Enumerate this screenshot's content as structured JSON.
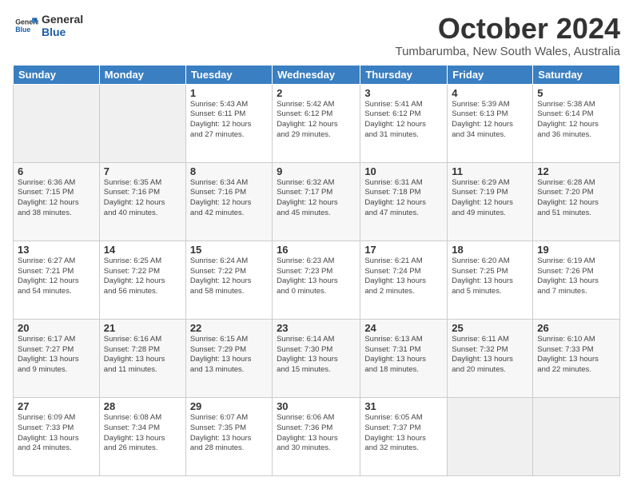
{
  "logo": {
    "line1": "General",
    "line2": "Blue"
  },
  "title": "October 2024",
  "subtitle": "Tumbarumba, New South Wales, Australia",
  "weekdays": [
    "Sunday",
    "Monday",
    "Tuesday",
    "Wednesday",
    "Thursday",
    "Friday",
    "Saturday"
  ],
  "weeks": [
    [
      {
        "day": "",
        "info": ""
      },
      {
        "day": "",
        "info": ""
      },
      {
        "day": "1",
        "info": "Sunrise: 5:43 AM\nSunset: 6:11 PM\nDaylight: 12 hours\nand 27 minutes."
      },
      {
        "day": "2",
        "info": "Sunrise: 5:42 AM\nSunset: 6:12 PM\nDaylight: 12 hours\nand 29 minutes."
      },
      {
        "day": "3",
        "info": "Sunrise: 5:41 AM\nSunset: 6:12 PM\nDaylight: 12 hours\nand 31 minutes."
      },
      {
        "day": "4",
        "info": "Sunrise: 5:39 AM\nSunset: 6:13 PM\nDaylight: 12 hours\nand 34 minutes."
      },
      {
        "day": "5",
        "info": "Sunrise: 5:38 AM\nSunset: 6:14 PM\nDaylight: 12 hours\nand 36 minutes."
      }
    ],
    [
      {
        "day": "6",
        "info": "Sunrise: 6:36 AM\nSunset: 7:15 PM\nDaylight: 12 hours\nand 38 minutes."
      },
      {
        "day": "7",
        "info": "Sunrise: 6:35 AM\nSunset: 7:16 PM\nDaylight: 12 hours\nand 40 minutes."
      },
      {
        "day": "8",
        "info": "Sunrise: 6:34 AM\nSunset: 7:16 PM\nDaylight: 12 hours\nand 42 minutes."
      },
      {
        "day": "9",
        "info": "Sunrise: 6:32 AM\nSunset: 7:17 PM\nDaylight: 12 hours\nand 45 minutes."
      },
      {
        "day": "10",
        "info": "Sunrise: 6:31 AM\nSunset: 7:18 PM\nDaylight: 12 hours\nand 47 minutes."
      },
      {
        "day": "11",
        "info": "Sunrise: 6:29 AM\nSunset: 7:19 PM\nDaylight: 12 hours\nand 49 minutes."
      },
      {
        "day": "12",
        "info": "Sunrise: 6:28 AM\nSunset: 7:20 PM\nDaylight: 12 hours\nand 51 minutes."
      }
    ],
    [
      {
        "day": "13",
        "info": "Sunrise: 6:27 AM\nSunset: 7:21 PM\nDaylight: 12 hours\nand 54 minutes."
      },
      {
        "day": "14",
        "info": "Sunrise: 6:25 AM\nSunset: 7:22 PM\nDaylight: 12 hours\nand 56 minutes."
      },
      {
        "day": "15",
        "info": "Sunrise: 6:24 AM\nSunset: 7:22 PM\nDaylight: 12 hours\nand 58 minutes."
      },
      {
        "day": "16",
        "info": "Sunrise: 6:23 AM\nSunset: 7:23 PM\nDaylight: 13 hours\nand 0 minutes."
      },
      {
        "day": "17",
        "info": "Sunrise: 6:21 AM\nSunset: 7:24 PM\nDaylight: 13 hours\nand 2 minutes."
      },
      {
        "day": "18",
        "info": "Sunrise: 6:20 AM\nSunset: 7:25 PM\nDaylight: 13 hours\nand 5 minutes."
      },
      {
        "day": "19",
        "info": "Sunrise: 6:19 AM\nSunset: 7:26 PM\nDaylight: 13 hours\nand 7 minutes."
      }
    ],
    [
      {
        "day": "20",
        "info": "Sunrise: 6:17 AM\nSunset: 7:27 PM\nDaylight: 13 hours\nand 9 minutes."
      },
      {
        "day": "21",
        "info": "Sunrise: 6:16 AM\nSunset: 7:28 PM\nDaylight: 13 hours\nand 11 minutes."
      },
      {
        "day": "22",
        "info": "Sunrise: 6:15 AM\nSunset: 7:29 PM\nDaylight: 13 hours\nand 13 minutes."
      },
      {
        "day": "23",
        "info": "Sunrise: 6:14 AM\nSunset: 7:30 PM\nDaylight: 13 hours\nand 15 minutes."
      },
      {
        "day": "24",
        "info": "Sunrise: 6:13 AM\nSunset: 7:31 PM\nDaylight: 13 hours\nand 18 minutes."
      },
      {
        "day": "25",
        "info": "Sunrise: 6:11 AM\nSunset: 7:32 PM\nDaylight: 13 hours\nand 20 minutes."
      },
      {
        "day": "26",
        "info": "Sunrise: 6:10 AM\nSunset: 7:33 PM\nDaylight: 13 hours\nand 22 minutes."
      }
    ],
    [
      {
        "day": "27",
        "info": "Sunrise: 6:09 AM\nSunset: 7:33 PM\nDaylight: 13 hours\nand 24 minutes."
      },
      {
        "day": "28",
        "info": "Sunrise: 6:08 AM\nSunset: 7:34 PM\nDaylight: 13 hours\nand 26 minutes."
      },
      {
        "day": "29",
        "info": "Sunrise: 6:07 AM\nSunset: 7:35 PM\nDaylight: 13 hours\nand 28 minutes."
      },
      {
        "day": "30",
        "info": "Sunrise: 6:06 AM\nSunset: 7:36 PM\nDaylight: 13 hours\nand 30 minutes."
      },
      {
        "day": "31",
        "info": "Sunrise: 6:05 AM\nSunset: 7:37 PM\nDaylight: 13 hours\nand 32 minutes."
      },
      {
        "day": "",
        "info": ""
      },
      {
        "day": "",
        "info": ""
      }
    ]
  ]
}
